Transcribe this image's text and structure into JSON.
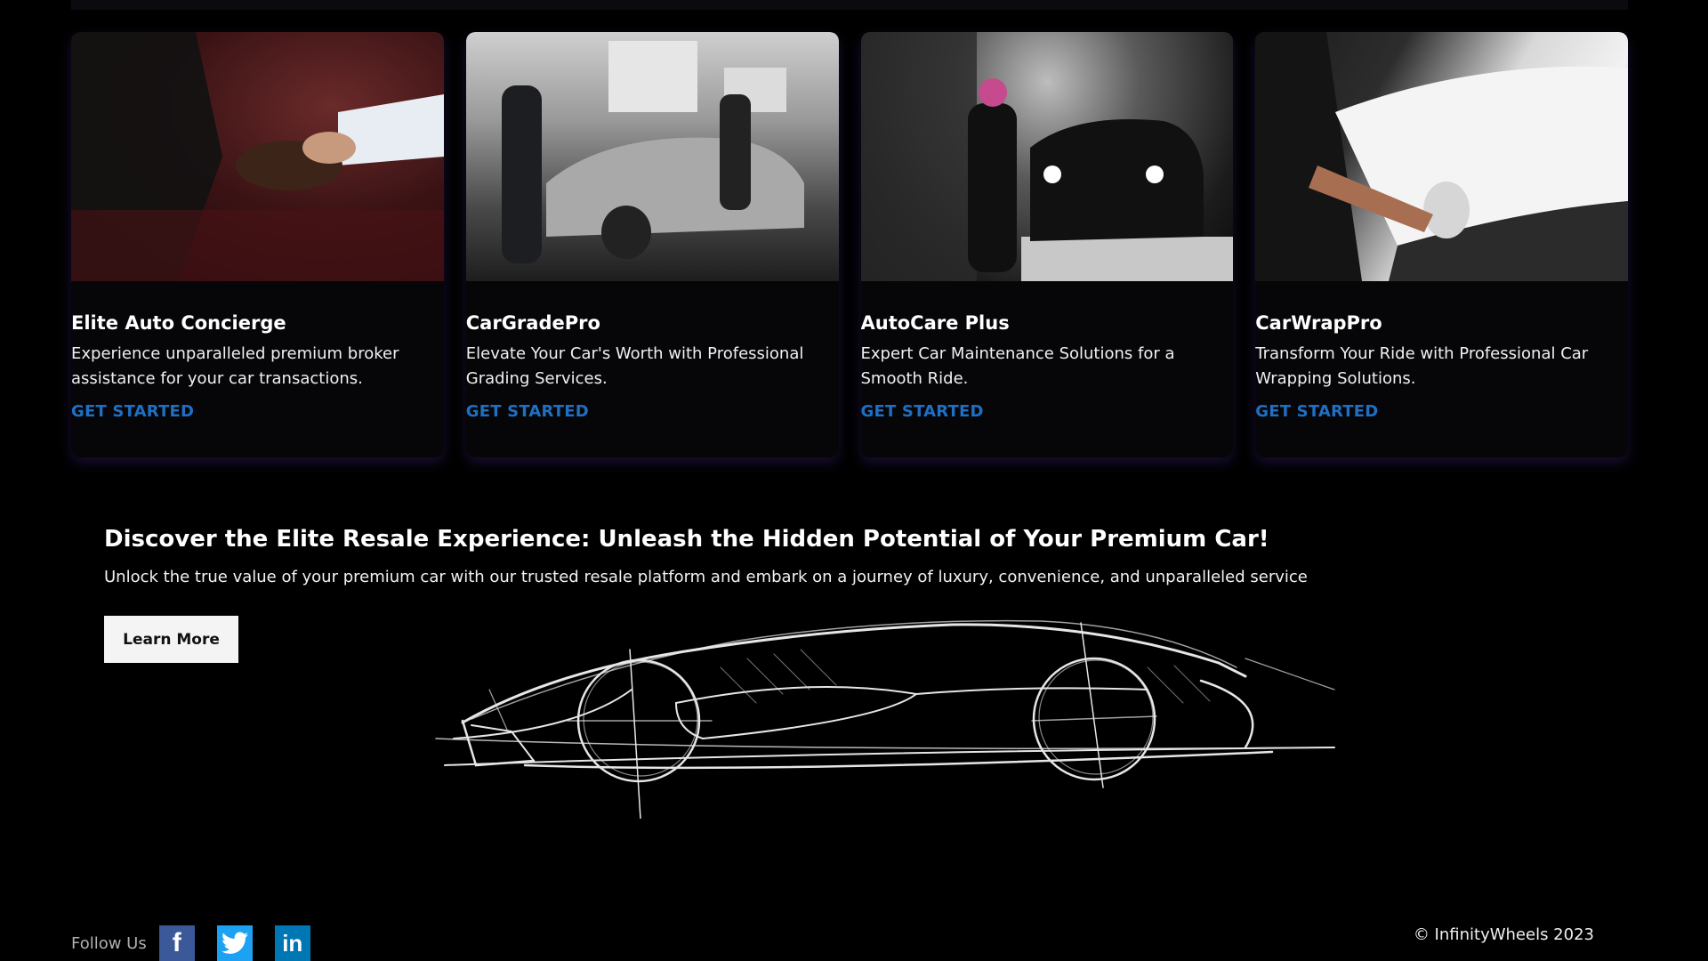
{
  "cards": [
    {
      "title": "Elite Auto Concierge",
      "description": "Experience unparalleled premium broker assistance for your car transactions.",
      "cta": "GET STARTED",
      "image": "handshake-photo"
    },
    {
      "title": "CarGradePro",
      "description": "Elevate Your Car's Worth with Professional Grading Services.",
      "cta": "GET STARTED",
      "image": "garage-restoration-photo"
    },
    {
      "title": "AutoCare Plus",
      "description": "Expert Car Maintenance Solutions for a Smooth Ride.",
      "cta": "GET STARTED",
      "image": "car-wash-photo"
    },
    {
      "title": "CarWrapPro",
      "description": "Transform Your Ride with Professional Car Wrapping Solutions.",
      "cta": "GET STARTED",
      "image": "car-wrapping-photo"
    }
  ],
  "promo": {
    "title": "Discover the Elite Resale Experience: Unleash the Hidden Potential of Your Premium Car!",
    "text": "Unlock the true value of your premium car with our trusted resale platform and embark on a journey of luxury, convenience, and unparalleled service",
    "button": "Learn More",
    "illustration": "car-sketch-illustration"
  },
  "footer": {
    "follow_label": "Follow Us",
    "social": [
      {
        "name": "facebook-icon",
        "glyph": "f",
        "color": "#3b5998"
      },
      {
        "name": "twitter-icon",
        "glyph": "bird",
        "color": "#1da1f2"
      },
      {
        "name": "linkedin-icon",
        "glyph": "in",
        "color": "#0077b5"
      }
    ],
    "copyright": "© InfinityWheels 2023"
  },
  "colors": {
    "background": "#000000",
    "link": "#1f6fc4",
    "card_bg": "#060608"
  }
}
